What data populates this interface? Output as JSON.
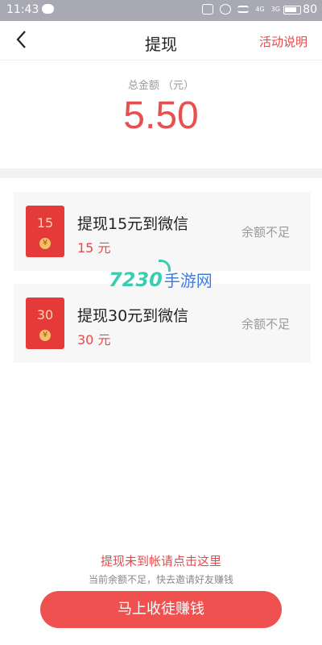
{
  "status_bar": {
    "time": "11:43",
    "signal_labels": [
      "4G",
      "3G"
    ],
    "battery": "80",
    "battery_level": 0.8
  },
  "header": {
    "title": "提现",
    "rules_link": "活动说明"
  },
  "balance": {
    "label": "总金额 （元）",
    "value": "5.50"
  },
  "options": [
    {
      "envelope_amount": "15",
      "title": "提现15元到微信",
      "amount_text": "15 元",
      "status": "余额不足"
    },
    {
      "envelope_amount": "30",
      "title": "提现30元到微信",
      "amount_text": "30 元",
      "status": "余额不足"
    }
  ],
  "watermark": {
    "number": "7230",
    "text": "手游网"
  },
  "footer": {
    "link": "提现未到帐请点击这里",
    "hint": "当前余额不足，快去邀请好友赚钱",
    "button": "马上收徒赚钱"
  },
  "icons": {
    "coin": "¥"
  },
  "colors": {
    "accent": "#e84848",
    "button": "#ef5050",
    "envelope": "#e43a3a"
  }
}
